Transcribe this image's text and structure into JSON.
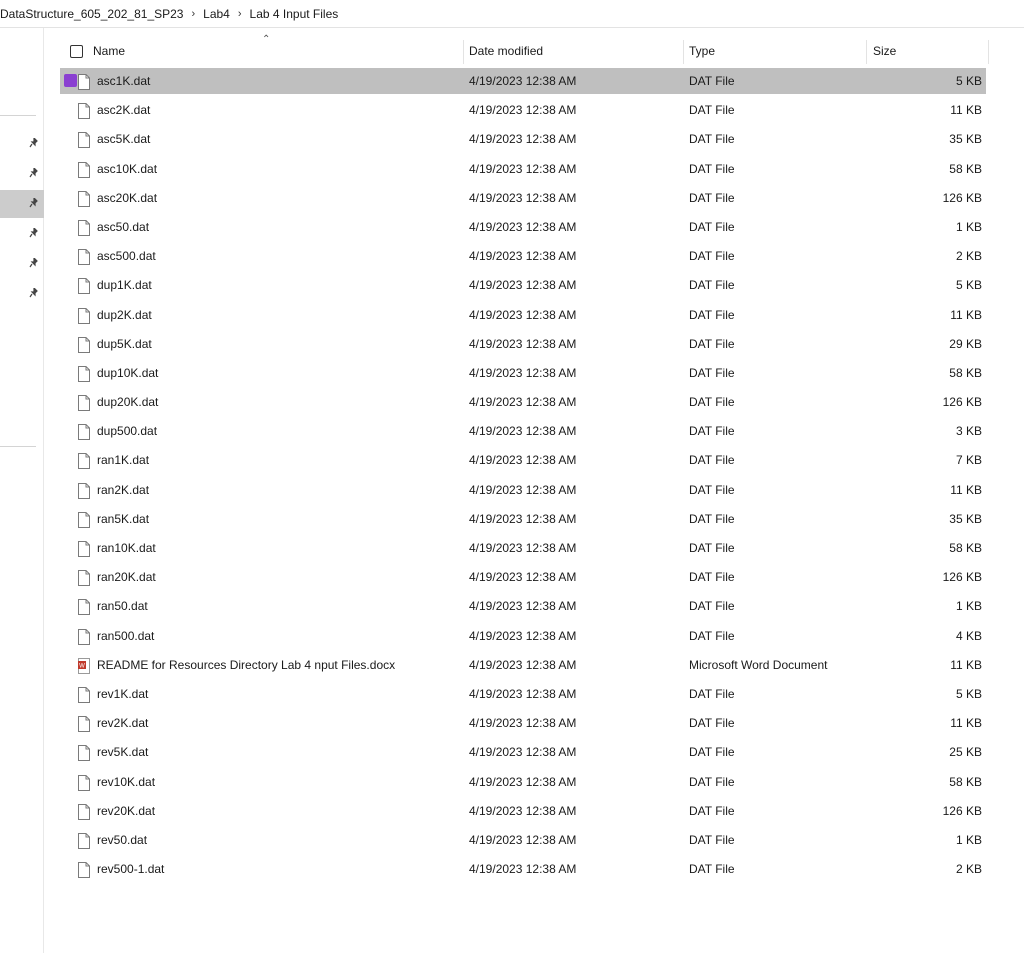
{
  "breadcrumb": {
    "items": [
      "DataStructure_605_202_81_SP23",
      "Lab4",
      "Lab 4 Input Files"
    ]
  },
  "columns": {
    "name": "Name",
    "date_modified": "Date modified",
    "type": "Type",
    "size": "Size"
  },
  "icons": {
    "dat": "file-icon",
    "docx": "word-document-icon",
    "pin": "pin-icon"
  },
  "colors": {
    "selection": "#bfbfbf",
    "selection_checkbox": "#8a3fd1",
    "word_icon": "#c0392b"
  },
  "files": [
    {
      "name": "asc1K.dat",
      "date": "4/19/2023 12:38 AM",
      "type": "DAT File",
      "size": "5 KB",
      "icon": "dat",
      "selected": true
    },
    {
      "name": "asc2K.dat",
      "date": "4/19/2023 12:38 AM",
      "type": "DAT File",
      "size": "11 KB",
      "icon": "dat"
    },
    {
      "name": "asc5K.dat",
      "date": "4/19/2023 12:38 AM",
      "type": "DAT File",
      "size": "35 KB",
      "icon": "dat"
    },
    {
      "name": "asc10K.dat",
      "date": "4/19/2023 12:38 AM",
      "type": "DAT File",
      "size": "58 KB",
      "icon": "dat"
    },
    {
      "name": "asc20K.dat",
      "date": "4/19/2023 12:38 AM",
      "type": "DAT File",
      "size": "126 KB",
      "icon": "dat"
    },
    {
      "name": "asc50.dat",
      "date": "4/19/2023 12:38 AM",
      "type": "DAT File",
      "size": "1 KB",
      "icon": "dat"
    },
    {
      "name": "asc500.dat",
      "date": "4/19/2023 12:38 AM",
      "type": "DAT File",
      "size": "2 KB",
      "icon": "dat"
    },
    {
      "name": "dup1K.dat",
      "date": "4/19/2023 12:38 AM",
      "type": "DAT File",
      "size": "5 KB",
      "icon": "dat"
    },
    {
      "name": "dup2K.dat",
      "date": "4/19/2023 12:38 AM",
      "type": "DAT File",
      "size": "11 KB",
      "icon": "dat"
    },
    {
      "name": "dup5K.dat",
      "date": "4/19/2023 12:38 AM",
      "type": "DAT File",
      "size": "29 KB",
      "icon": "dat"
    },
    {
      "name": "dup10K.dat",
      "date": "4/19/2023 12:38 AM",
      "type": "DAT File",
      "size": "58 KB",
      "icon": "dat"
    },
    {
      "name": "dup20K.dat",
      "date": "4/19/2023 12:38 AM",
      "type": "DAT File",
      "size": "126 KB",
      "icon": "dat"
    },
    {
      "name": "dup500.dat",
      "date": "4/19/2023 12:38 AM",
      "type": "DAT File",
      "size": "3 KB",
      "icon": "dat"
    },
    {
      "name": "ran1K.dat",
      "date": "4/19/2023 12:38 AM",
      "type": "DAT File",
      "size": "7 KB",
      "icon": "dat"
    },
    {
      "name": "ran2K.dat",
      "date": "4/19/2023 12:38 AM",
      "type": "DAT File",
      "size": "11 KB",
      "icon": "dat"
    },
    {
      "name": "ran5K.dat",
      "date": "4/19/2023 12:38 AM",
      "type": "DAT File",
      "size": "35 KB",
      "icon": "dat"
    },
    {
      "name": "ran10K.dat",
      "date": "4/19/2023 12:38 AM",
      "type": "DAT File",
      "size": "58 KB",
      "icon": "dat"
    },
    {
      "name": "ran20K.dat",
      "date": "4/19/2023 12:38 AM",
      "type": "DAT File",
      "size": "126 KB",
      "icon": "dat"
    },
    {
      "name": "ran50.dat",
      "date": "4/19/2023 12:38 AM",
      "type": "DAT File",
      "size": "1 KB",
      "icon": "dat"
    },
    {
      "name": "ran500.dat",
      "date": "4/19/2023 12:38 AM",
      "type": "DAT File",
      "size": "4 KB",
      "icon": "dat"
    },
    {
      "name": "README for Resources Directory Lab 4 nput Files.docx",
      "date": "4/19/2023 12:38 AM",
      "type": "Microsoft Word Document",
      "size": "11 KB",
      "icon": "docx"
    },
    {
      "name": "rev1K.dat",
      "date": "4/19/2023 12:38 AM",
      "type": "DAT File",
      "size": "5 KB",
      "icon": "dat"
    },
    {
      "name": "rev2K.dat",
      "date": "4/19/2023 12:38 AM",
      "type": "DAT File",
      "size": "11 KB",
      "icon": "dat"
    },
    {
      "name": "rev5K.dat",
      "date": "4/19/2023 12:38 AM",
      "type": "DAT File",
      "size": "25 KB",
      "icon": "dat"
    },
    {
      "name": "rev10K.dat",
      "date": "4/19/2023 12:38 AM",
      "type": "DAT File",
      "size": "58 KB",
      "icon": "dat"
    },
    {
      "name": "rev20K.dat",
      "date": "4/19/2023 12:38 AM",
      "type": "DAT File",
      "size": "126 KB",
      "icon": "dat"
    },
    {
      "name": "rev50.dat",
      "date": "4/19/2023 12:38 AM",
      "type": "DAT File",
      "size": "1 KB",
      "icon": "dat"
    },
    {
      "name": "rev500-1.dat",
      "date": "4/19/2023 12:38 AM",
      "type": "DAT File",
      "size": "2 KB",
      "icon": "dat"
    }
  ]
}
